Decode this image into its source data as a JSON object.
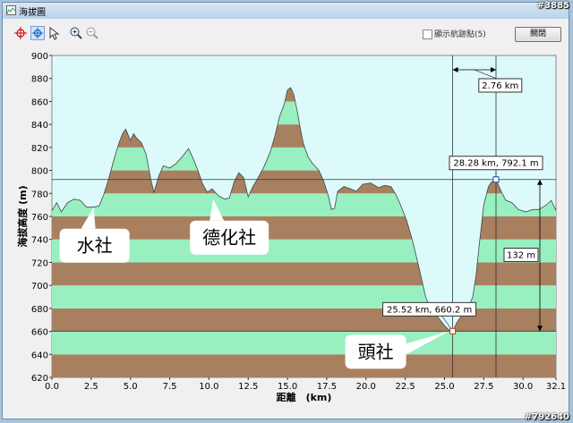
{
  "window": {
    "title": "海拔圖"
  },
  "watermark": {
    "top": "#3885",
    "bottom": "#792640"
  },
  "toolbar": {
    "tools": [
      "crosshair-icon",
      "crosshair-select-icon",
      "pointer-icon",
      "zoom-in-icon",
      "zoom-out-icon"
    ],
    "checkbox_label": "顯示航跡點(5)",
    "close_label": "關閉"
  },
  "chart_data": {
    "type": "area",
    "xlabel": "距離　(km)",
    "ylabel": "海拔高度 (m)",
    "xlim": [
      0,
      32.1
    ],
    "ylim": [
      620,
      900
    ],
    "x_ticks": [
      "0.0",
      "2.5",
      "5.0",
      "7.5",
      "10.0",
      "12.5",
      "15.0",
      "17.5",
      "20.0",
      "22.5",
      "25.0",
      "27.5",
      "30.0",
      "32.1"
    ],
    "y_ticks": [
      "620",
      "640",
      "660",
      "680",
      "700",
      "720",
      "740",
      "760",
      "780",
      "800",
      "820",
      "840",
      "860",
      "880",
      "900"
    ],
    "band_colors": [
      "#a88060",
      "#98f0c0"
    ],
    "profile": [
      [
        0,
        765
      ],
      [
        0.3,
        772
      ],
      [
        0.6,
        764
      ],
      [
        1.0,
        772
      ],
      [
        1.4,
        775
      ],
      [
        1.8,
        774
      ],
      [
        2.2,
        768
      ],
      [
        2.6,
        768
      ],
      [
        3.0,
        769
      ],
      [
        3.3,
        779
      ],
      [
        3.6,
        792
      ],
      [
        4.0,
        812
      ],
      [
        4.3,
        825
      ],
      [
        4.5,
        832
      ],
      [
        4.7,
        836
      ],
      [
        5.0,
        826
      ],
      [
        5.2,
        832
      ],
      [
        5.4,
        828
      ],
      [
        5.7,
        824
      ],
      [
        6.0,
        814
      ],
      [
        6.3,
        792
      ],
      [
        6.5,
        781
      ],
      [
        6.8,
        795
      ],
      [
        7.1,
        804
      ],
      [
        7.5,
        802
      ],
      [
        7.9,
        806
      ],
      [
        8.3,
        812
      ],
      [
        8.7,
        819
      ],
      [
        9.0,
        810
      ],
      [
        9.3,
        800
      ],
      [
        9.6,
        788
      ],
      [
        9.9,
        781
      ],
      [
        10.2,
        784
      ],
      [
        10.6,
        778
      ],
      [
        11.0,
        775
      ],
      [
        11.3,
        776
      ],
      [
        11.6,
        790
      ],
      [
        11.9,
        798
      ],
      [
        12.2,
        794
      ],
      [
        12.5,
        777
      ],
      [
        12.8,
        786
      ],
      [
        13.1,
        793
      ],
      [
        13.5,
        803
      ],
      [
        13.9,
        816
      ],
      [
        14.2,
        830
      ],
      [
        14.5,
        847
      ],
      [
        14.8,
        858
      ],
      [
        15.0,
        870
      ],
      [
        15.2,
        872
      ],
      [
        15.4,
        866
      ],
      [
        15.6,
        853
      ],
      [
        15.8,
        838
      ],
      [
        16.0,
        824
      ],
      [
        16.3,
        812
      ],
      [
        16.6,
        806
      ],
      [
        17.0,
        800
      ],
      [
        17.3,
        791
      ],
      [
        17.6,
        778
      ],
      [
        17.8,
        766
      ],
      [
        18.0,
        767
      ],
      [
        18.2,
        782
      ],
      [
        18.6,
        786
      ],
      [
        19.0,
        784
      ],
      [
        19.4,
        782
      ],
      [
        19.8,
        788
      ],
      [
        20.3,
        789
      ],
      [
        20.8,
        785
      ],
      [
        21.2,
        787
      ],
      [
        21.6,
        786
      ],
      [
        21.9,
        779
      ],
      [
        22.2,
        770
      ],
      [
        22.6,
        756
      ],
      [
        23.0,
        737
      ],
      [
        23.4,
        714
      ],
      [
        23.8,
        690
      ],
      [
        24.2,
        677
      ],
      [
        24.6,
        672
      ],
      [
        25.0,
        665
      ],
      [
        25.3,
        661
      ],
      [
        25.52,
        660.2
      ],
      [
        25.8,
        668
      ],
      [
        26.1,
        674
      ],
      [
        26.5,
        680
      ],
      [
        26.8,
        690
      ],
      [
        27.0,
        708
      ],
      [
        27.2,
        734
      ],
      [
        27.5,
        770
      ],
      [
        27.8,
        786
      ],
      [
        28.0,
        790
      ],
      [
        28.28,
        792.1
      ],
      [
        28.6,
        782
      ],
      [
        28.9,
        774
      ],
      [
        29.3,
        772
      ],
      [
        29.7,
        766
      ],
      [
        30.2,
        764
      ],
      [
        30.6,
        766
      ],
      [
        31.0,
        766
      ],
      [
        31.5,
        770
      ],
      [
        31.8,
        774
      ],
      [
        32.1,
        765
      ]
    ],
    "crosshair_a": {
      "x": 25.52,
      "y": 660.2,
      "label": "25.52 km, 660.2 m"
    },
    "crosshair_b": {
      "x": 28.28,
      "y": 792.1,
      "label": "28.28 km, 792.1 m"
    },
    "dx_label": "2.76 km",
    "dy_label": "132 m",
    "place_labels": [
      {
        "text": "水社",
        "x": 3.0,
        "y": 768
      },
      {
        "text": "德化社",
        "x": 10.5,
        "y": 775
      },
      {
        "text": "頭社",
        "x": 25.52,
        "y": 660.2
      }
    ]
  }
}
